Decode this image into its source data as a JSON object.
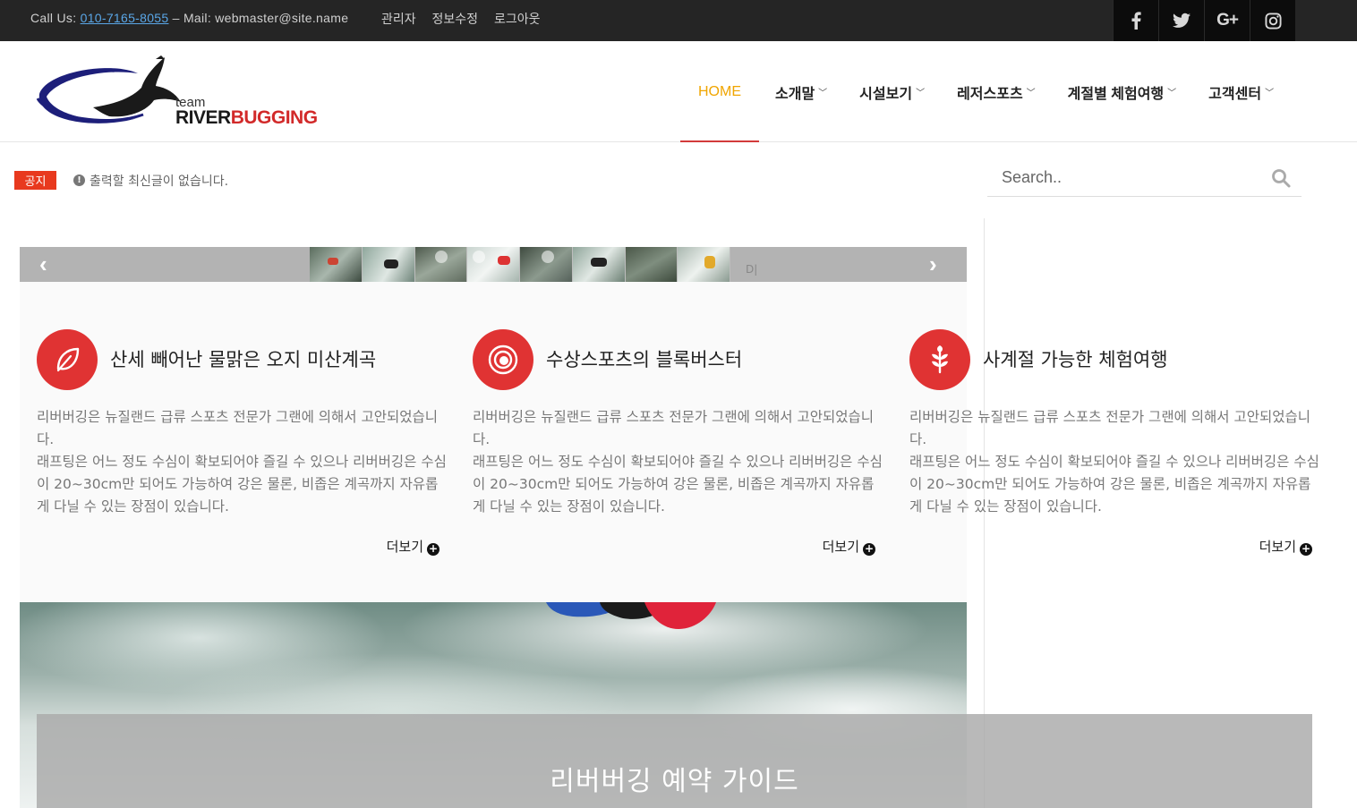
{
  "topbar": {
    "contact_prefix": "Call Us: ",
    "phone": "010-7165-8055",
    "mail_text": " – Mail: webmaster@site.name",
    "links": [
      "관리자",
      "정보수정",
      "로그아웃"
    ],
    "social": [
      {
        "icon": "facebook-icon",
        "glyph": "f"
      },
      {
        "icon": "twitter-icon",
        "glyph": "🐦"
      },
      {
        "icon": "google-plus-icon",
        "glyph": "G+"
      },
      {
        "icon": "instagram-icon",
        "glyph": "◎"
      }
    ]
  },
  "header": {
    "logo_small": "team",
    "logo_brand_1": "RIVER",
    "logo_brand_2": "BUGGING",
    "nav": [
      {
        "label": "HOME",
        "active": true
      },
      {
        "label": "소개말",
        "active": false
      },
      {
        "label": "시설보기",
        "active": false
      },
      {
        "label": "레저스포츠",
        "active": false
      },
      {
        "label": "계절별 체험여행",
        "active": false
      },
      {
        "label": "고객센터",
        "active": false
      }
    ]
  },
  "notice": {
    "badge": "공지",
    "text": "출력할 최신글이 없습니다."
  },
  "search": {
    "placeholder": "Search.."
  },
  "slider": {
    "more_label": "D|"
  },
  "features": [
    {
      "icon": "leaf-icon",
      "title": "산세 빼어난 물맑은 오지 미산계곡",
      "body": "리버버깅은 뉴질랜드 급류 스포츠 전문가 그랜에 의해서 고안되었습니다.\n래프팅은 어느 정도 수심이 확보되어야 즐길 수 있으나 리버버깅은 수심이 20~30cm만 되어도 가능하여 강은 물론, 비좁은 계곡까지 자유롭게 다닐 수 있는 장점이 있습니다.",
      "more": "더보기"
    },
    {
      "icon": "target-icon",
      "title": "수상스포츠의 블록버스터",
      "body": "리버버깅은 뉴질랜드 급류 스포츠 전문가 그랜에 의해서 고안되었습니다.\n래프팅은 어느 정도 수심이 확보되어야 즐길 수 있으나 리버버깅은 수심이 20~30cm만 되어도 가능하여 강은 물론, 비좁은 계곡까지 자유롭게 다닐 수 있는 장점이 있습니다.",
      "more": "더보기"
    },
    {
      "icon": "plant-icon",
      "title": "사계절 가능한 체험여행",
      "body": "리버버깅은 뉴질랜드 급류 스포츠 전문가 그랜에 의해서 고안되었습니다.\n래프팅은 어느 정도 수심이 확보되어야 즐길 수 있으나 리버버깅은 수심이 20~30cm만 되어도 가능하여 강은 물론, 비좁은 계곡까지 자유롭게 다닐 수 있는 장점이 있습니다.",
      "more": "더보기"
    }
  ],
  "guide": {
    "title": "리버버깅 예약 가이드"
  },
  "colors": {
    "accent_red": "#e03333",
    "nav_active": "#f0a500",
    "notice_red": "#e8391e"
  }
}
